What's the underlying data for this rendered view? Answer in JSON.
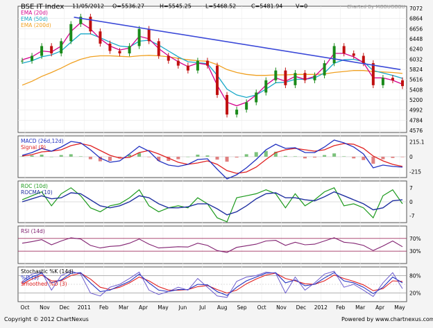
{
  "header": {
    "title": "BSE IT Index",
    "date": "11/05/2012",
    "open": "O=5536.27",
    "high": "H=5545.25",
    "low": "L=5468.52",
    "close": "C=5481.94",
    "volume": "V=0",
    "charted_by": "Charted By MOBUGOBU"
  },
  "footer": {
    "copyright": "Copyright © 2012 ChartNexus",
    "powered": "Powered by www.chartnexus.com"
  },
  "colors": {
    "ema20": "#d4008c",
    "ema50": "#17a8c8",
    "ema200": "#f0a020",
    "trendline": "#3b49d8",
    "macd": "#2030c0",
    "signal": "#e02020",
    "roc": "#1c9a1c",
    "rocma": "#2030a0",
    "rsi": "#802070",
    "stochK": "#6a5acd",
    "stochD": "#2030c0",
    "stochSD": "#e02020"
  },
  "chart_data": [
    {
      "type": "candlestick",
      "title": "BSE IT Index",
      "legend": [
        "EMA (20d)",
        "EMA (50d)",
        "EMA (200d)"
      ],
      "y_ticks": [
        "7072",
        "6864",
        "6656",
        "6448",
        "6240",
        "6032",
        "5824",
        "5616",
        "5408",
        "5200",
        "4992",
        "4784",
        "4576"
      ],
      "ylim": [
        4576,
        7072
      ],
      "x_ticks": [
        "Oct",
        "Nov",
        "Dec",
        "2011",
        "Feb",
        "Mar",
        "Apr",
        "May",
        "Jun",
        "Jul",
        "Aug",
        "Sep",
        "Oct",
        "Nov",
        "Dec",
        "2012",
        "Feb",
        "Mar",
        "Apr",
        "May"
      ],
      "close_series": [
        {
          "d": "2010-10-01",
          "c": 6000
        },
        {
          "d": "2010-10-15",
          "c": 6100
        },
        {
          "d": "2010-11-01",
          "c": 6300
        },
        {
          "d": "2010-11-15",
          "c": 6150
        },
        {
          "d": "2010-12-01",
          "c": 6400
        },
        {
          "d": "2010-12-15",
          "c": 6750
        },
        {
          "d": "2011-01-01",
          "c": 6900
        },
        {
          "d": "2011-01-15",
          "c": 6600
        },
        {
          "d": "2011-02-01",
          "c": 6350
        },
        {
          "d": "2011-02-15",
          "c": 6200
        },
        {
          "d": "2011-03-01",
          "c": 6150
        },
        {
          "d": "2011-03-15",
          "c": 6300
        },
        {
          "d": "2011-04-01",
          "c": 6650
        },
        {
          "d": "2011-04-15",
          "c": 6400
        },
        {
          "d": "2011-05-01",
          "c": 6100
        },
        {
          "d": "2011-05-15",
          "c": 6000
        },
        {
          "d": "2011-06-01",
          "c": 5900
        },
        {
          "d": "2011-06-15",
          "c": 5800
        },
        {
          "d": "2011-07-01",
          "c": 6000
        },
        {
          "d": "2011-07-15",
          "c": 5900
        },
        {
          "d": "2011-08-01",
          "c": 5300
        },
        {
          "d": "2011-08-15",
          "c": 4900
        },
        {
          "d": "2011-09-01",
          "c": 5000
        },
        {
          "d": "2011-09-15",
          "c": 5150
        },
        {
          "d": "2011-10-01",
          "c": 5350
        },
        {
          "d": "2011-10-15",
          "c": 5600
        },
        {
          "d": "2011-11-01",
          "c": 5800
        },
        {
          "d": "2011-11-15",
          "c": 5500
        },
        {
          "d": "2011-12-01",
          "c": 5750
        },
        {
          "d": "2011-12-15",
          "c": 5600
        },
        {
          "d": "2012-01-01",
          "c": 5700
        },
        {
          "d": "2012-01-15",
          "c": 5950
        },
        {
          "d": "2012-02-01",
          "c": 6300
        },
        {
          "d": "2012-02-15",
          "c": 6150
        },
        {
          "d": "2012-03-01",
          "c": 6100
        },
        {
          "d": "2012-03-15",
          "c": 5950
        },
        {
          "d": "2012-04-01",
          "c": 5500
        },
        {
          "d": "2012-04-15",
          "c": 5650
        },
        {
          "d": "2012-05-01",
          "c": 5600
        },
        {
          "d": "2012-05-11",
          "c": 5482
        }
      ],
      "ema20": [
        6020,
        6080,
        6200,
        6180,
        6300,
        6600,
        6780,
        6650,
        6450,
        6300,
        6220,
        6260,
        6500,
        6450,
        6250,
        6100,
        5980,
        5880,
        5950,
        5920,
        5500,
        5150,
        5080,
        5150,
        5300,
        5500,
        5650,
        5580,
        5680,
        5620,
        5680,
        5880,
        6150,
        6150,
        6080,
        5960,
        5650,
        5650,
        5600,
        5520
      ],
      "ema50": [
        5950,
        6000,
        6080,
        6120,
        6200,
        6380,
        6550,
        6550,
        6470,
        6380,
        6300,
        6280,
        6400,
        6420,
        6320,
        6200,
        6080,
        5980,
        5960,
        5940,
        5700,
        5420,
        5300,
        5250,
        5300,
        5420,
        5550,
        5560,
        5620,
        5620,
        5650,
        5750,
        5950,
        6020,
        6030,
        5980,
        5800,
        5750,
        5700,
        5640
      ],
      "ema200": [
        5500,
        5580,
        5680,
        5760,
        5850,
        5950,
        6030,
        6080,
        6100,
        6100,
        6090,
        6080,
        6100,
        6110,
        6100,
        6080,
        6050,
        6020,
        6000,
        5990,
        5920,
        5820,
        5760,
        5720,
        5700,
        5700,
        5710,
        5710,
        5720,
        5720,
        5720,
        5730,
        5760,
        5780,
        5800,
        5800,
        5780,
        5770,
        5760,
        5740
      ],
      "trendline": [
        {
          "d": "2010-12-20",
          "v": 6890
        },
        {
          "d": "2012-05-08",
          "v": 5820
        }
      ]
    },
    {
      "type": "line",
      "title": "MACD",
      "legend": [
        "MACD (26d,12d)",
        "Signal (9)"
      ],
      "y_ticks": [
        "215.1",
        "0",
        "-215"
      ],
      "ylim": [
        -260,
        260
      ],
      "macd": [
        20,
        60,
        120,
        80,
        140,
        220,
        200,
        100,
        -20,
        -80,
        -60,
        40,
        150,
        80,
        -60,
        -120,
        -140,
        -110,
        -40,
        -30,
        -180,
        -320,
        -260,
        -160,
        -40,
        100,
        180,
        120,
        130,
        60,
        60,
        140,
        240,
        200,
        140,
        40,
        -160,
        -120,
        -140,
        -150
      ],
      "signal": [
        10,
        30,
        70,
        80,
        100,
        160,
        190,
        160,
        90,
        20,
        -20,
        -10,
        60,
        90,
        40,
        -20,
        -80,
        -110,
        -90,
        -60,
        -110,
        -200,
        -240,
        -220,
        -150,
        -40,
        60,
        100,
        120,
        100,
        80,
        100,
        160,
        190,
        180,
        120,
        10,
        -60,
        -110,
        -140
      ]
    },
    {
      "type": "line",
      "title": "ROC",
      "legend": [
        "ROC (10d)",
        "ROCMA (10)"
      ],
      "y_ticks": [
        "7",
        "0",
        "-7"
      ],
      "ylim": [
        -9,
        9
      ],
      "roc": [
        1,
        3,
        5,
        -2,
        4,
        7,
        3,
        -3,
        -5,
        -2,
        -1,
        2,
        6,
        -2,
        -5,
        -3,
        -2,
        -3,
        2,
        -1,
        -8,
        -10,
        2,
        3,
        4,
        6,
        4,
        -3,
        4,
        -2,
        1,
        5,
        7,
        -2,
        -1,
        -3,
        -8,
        3,
        6,
        -1
      ],
      "rocma": [
        0,
        1.5,
        3,
        1.5,
        2,
        4.5,
        4,
        1,
        -2,
        -3,
        -2,
        0,
        3,
        2,
        -1,
        -3,
        -3,
        -2.5,
        -1,
        -1,
        -3.5,
        -6.5,
        -5,
        -2,
        1.5,
        4,
        4.5,
        2,
        2,
        1,
        0.5,
        2.5,
        5,
        3,
        1,
        -1,
        -4,
        -3,
        0.5,
        1
      ]
    },
    {
      "type": "line",
      "title": "RSI",
      "legend": [
        "RSI (14d)"
      ],
      "y_ticks": [
        "70%",
        "30%"
      ],
      "ylim": [
        0,
        100
      ],
      "rsi": [
        55,
        60,
        66,
        50,
        62,
        72,
        68,
        48,
        40,
        45,
        47,
        55,
        68,
        52,
        40,
        42,
        44,
        43,
        55,
        48,
        32,
        26,
        42,
        47,
        52,
        62,
        64,
        48,
        58,
        50,
        52,
        62,
        72,
        58,
        55,
        48,
        32,
        46,
        62,
        44
      ]
    },
    {
      "type": "line",
      "title": "Stochastic",
      "legend": [
        "Stochastic %K (14d)",
        "%D (3)",
        "Smoothed %D (3)"
      ],
      "y_ticks": [
        "80%",
        "20%"
      ],
      "ylim": [
        0,
        100
      ],
      "k": [
        60,
        85,
        92,
        30,
        80,
        95,
        85,
        20,
        10,
        40,
        50,
        70,
        92,
        30,
        15,
        25,
        40,
        30,
        70,
        40,
        10,
        5,
        60,
        75,
        80,
        92,
        88,
        20,
        75,
        30,
        55,
        85,
        95,
        40,
        50,
        30,
        8,
        55,
        90,
        35
      ],
      "d": [
        55,
        75,
        88,
        55,
        65,
        88,
        90,
        55,
        25,
        30,
        45,
        60,
        85,
        55,
        30,
        25,
        32,
        32,
        50,
        48,
        25,
        12,
        40,
        62,
        75,
        88,
        90,
        55,
        65,
        45,
        50,
        72,
        90,
        62,
        55,
        40,
        18,
        40,
        75,
        55
      ],
      "sd": [
        50,
        68,
        82,
        62,
        62,
        80,
        88,
        68,
        40,
        32,
        40,
        55,
        75,
        62,
        42,
        30,
        30,
        32,
        42,
        46,
        32,
        20,
        30,
        52,
        68,
        82,
        88,
        70,
        62,
        52,
        50,
        62,
        82,
        70,
        60,
        48,
        28,
        35,
        62,
        60
      ]
    }
  ]
}
